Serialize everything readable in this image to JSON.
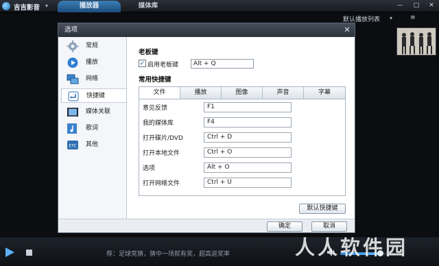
{
  "app": {
    "title": "吉吉影音",
    "tabs": [
      {
        "label": "播放器"
      },
      {
        "label": "媒体库"
      }
    ],
    "window_buttons": [
      "—",
      "□",
      "✕"
    ]
  },
  "playlist": {
    "title": "默认播放列表",
    "menu": "≡"
  },
  "dialog": {
    "title": "选项",
    "close_glyph": "✕",
    "sidebar": [
      {
        "label": "常规",
        "icon": "gear-icon"
      },
      {
        "label": "播放",
        "icon": "play-icon"
      },
      {
        "label": "网络",
        "icon": "network-icon"
      },
      {
        "label": "快捷键",
        "icon": "hotkey-icon",
        "active": true
      },
      {
        "label": "媒体关联",
        "icon": "media-association-icon"
      },
      {
        "label": "歌词",
        "icon": "lyrics-icon"
      },
      {
        "label": "其他",
        "icon": "other-icon"
      }
    ],
    "boss_key": {
      "section_title": "老板键",
      "checkbox_label": "启用老板键",
      "checked": true,
      "value": "Alt + Q"
    },
    "hotkeys": {
      "section_title": "常用快捷键",
      "tabs": [
        "文件",
        "播放",
        "图像",
        "声音",
        "字幕"
      ],
      "active_tab": 0,
      "rows": [
        {
          "label": "意见反馈",
          "key": "F1"
        },
        {
          "label": "我的媒体库",
          "key": "F4"
        },
        {
          "label": "打开碟片/DVD",
          "key": "Ctrl + D"
        },
        {
          "label": "打开本地文件",
          "key": "Ctrl + O"
        },
        {
          "label": "选项",
          "key": "Alt + O"
        },
        {
          "label": "打开网络文件",
          "key": "Ctrl + U"
        }
      ],
      "default_button": "默认快捷键"
    },
    "ok_button": "确定",
    "cancel_button": "取消"
  },
  "player": {
    "ticker": "荐：足球竞猜，猜中一场就有奖，超高返奖率",
    "volume": 0.72
  },
  "watermark": "人人软件园",
  "colors": {
    "accent": "#2b7fd0",
    "dialog_bg": "#eef2f7",
    "titlebar": "#2d333c"
  }
}
